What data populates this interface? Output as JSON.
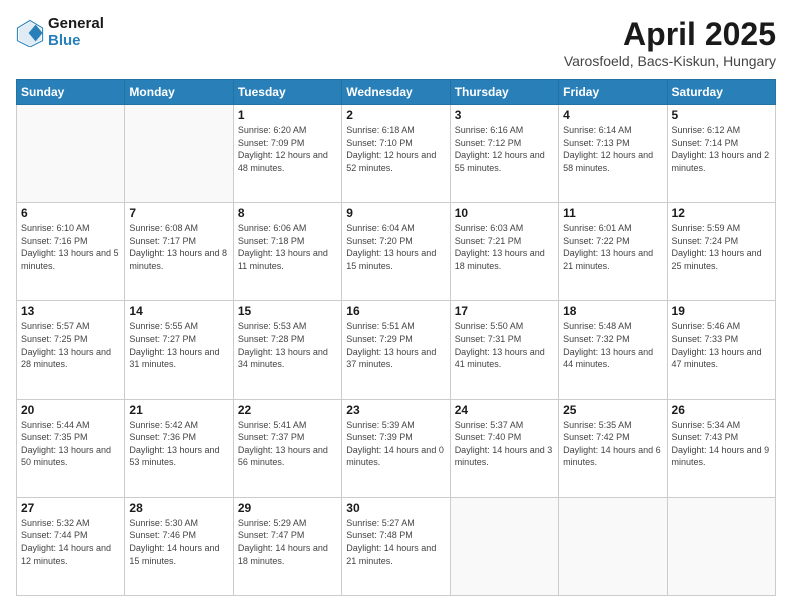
{
  "header": {
    "logo_line1": "General",
    "logo_line2": "Blue",
    "title": "April 2025",
    "subtitle": "Varosfoeld, Bacs-Kiskun, Hungary"
  },
  "days_of_week": [
    "Sunday",
    "Monday",
    "Tuesday",
    "Wednesday",
    "Thursday",
    "Friday",
    "Saturday"
  ],
  "weeks": [
    [
      {
        "num": "",
        "sunrise": "",
        "sunset": "",
        "daylight": ""
      },
      {
        "num": "",
        "sunrise": "",
        "sunset": "",
        "daylight": ""
      },
      {
        "num": "1",
        "sunrise": "Sunrise: 6:20 AM",
        "sunset": "Sunset: 7:09 PM",
        "daylight": "Daylight: 12 hours and 48 minutes."
      },
      {
        "num": "2",
        "sunrise": "Sunrise: 6:18 AM",
        "sunset": "Sunset: 7:10 PM",
        "daylight": "Daylight: 12 hours and 52 minutes."
      },
      {
        "num": "3",
        "sunrise": "Sunrise: 6:16 AM",
        "sunset": "Sunset: 7:12 PM",
        "daylight": "Daylight: 12 hours and 55 minutes."
      },
      {
        "num": "4",
        "sunrise": "Sunrise: 6:14 AM",
        "sunset": "Sunset: 7:13 PM",
        "daylight": "Daylight: 12 hours and 58 minutes."
      },
      {
        "num": "5",
        "sunrise": "Sunrise: 6:12 AM",
        "sunset": "Sunset: 7:14 PM",
        "daylight": "Daylight: 13 hours and 2 minutes."
      }
    ],
    [
      {
        "num": "6",
        "sunrise": "Sunrise: 6:10 AM",
        "sunset": "Sunset: 7:16 PM",
        "daylight": "Daylight: 13 hours and 5 minutes."
      },
      {
        "num": "7",
        "sunrise": "Sunrise: 6:08 AM",
        "sunset": "Sunset: 7:17 PM",
        "daylight": "Daylight: 13 hours and 8 minutes."
      },
      {
        "num": "8",
        "sunrise": "Sunrise: 6:06 AM",
        "sunset": "Sunset: 7:18 PM",
        "daylight": "Daylight: 13 hours and 11 minutes."
      },
      {
        "num": "9",
        "sunrise": "Sunrise: 6:04 AM",
        "sunset": "Sunset: 7:20 PM",
        "daylight": "Daylight: 13 hours and 15 minutes."
      },
      {
        "num": "10",
        "sunrise": "Sunrise: 6:03 AM",
        "sunset": "Sunset: 7:21 PM",
        "daylight": "Daylight: 13 hours and 18 minutes."
      },
      {
        "num": "11",
        "sunrise": "Sunrise: 6:01 AM",
        "sunset": "Sunset: 7:22 PM",
        "daylight": "Daylight: 13 hours and 21 minutes."
      },
      {
        "num": "12",
        "sunrise": "Sunrise: 5:59 AM",
        "sunset": "Sunset: 7:24 PM",
        "daylight": "Daylight: 13 hours and 25 minutes."
      }
    ],
    [
      {
        "num": "13",
        "sunrise": "Sunrise: 5:57 AM",
        "sunset": "Sunset: 7:25 PM",
        "daylight": "Daylight: 13 hours and 28 minutes."
      },
      {
        "num": "14",
        "sunrise": "Sunrise: 5:55 AM",
        "sunset": "Sunset: 7:27 PM",
        "daylight": "Daylight: 13 hours and 31 minutes."
      },
      {
        "num": "15",
        "sunrise": "Sunrise: 5:53 AM",
        "sunset": "Sunset: 7:28 PM",
        "daylight": "Daylight: 13 hours and 34 minutes."
      },
      {
        "num": "16",
        "sunrise": "Sunrise: 5:51 AM",
        "sunset": "Sunset: 7:29 PM",
        "daylight": "Daylight: 13 hours and 37 minutes."
      },
      {
        "num": "17",
        "sunrise": "Sunrise: 5:50 AM",
        "sunset": "Sunset: 7:31 PM",
        "daylight": "Daylight: 13 hours and 41 minutes."
      },
      {
        "num": "18",
        "sunrise": "Sunrise: 5:48 AM",
        "sunset": "Sunset: 7:32 PM",
        "daylight": "Daylight: 13 hours and 44 minutes."
      },
      {
        "num": "19",
        "sunrise": "Sunrise: 5:46 AM",
        "sunset": "Sunset: 7:33 PM",
        "daylight": "Daylight: 13 hours and 47 minutes."
      }
    ],
    [
      {
        "num": "20",
        "sunrise": "Sunrise: 5:44 AM",
        "sunset": "Sunset: 7:35 PM",
        "daylight": "Daylight: 13 hours and 50 minutes."
      },
      {
        "num": "21",
        "sunrise": "Sunrise: 5:42 AM",
        "sunset": "Sunset: 7:36 PM",
        "daylight": "Daylight: 13 hours and 53 minutes."
      },
      {
        "num": "22",
        "sunrise": "Sunrise: 5:41 AM",
        "sunset": "Sunset: 7:37 PM",
        "daylight": "Daylight: 13 hours and 56 minutes."
      },
      {
        "num": "23",
        "sunrise": "Sunrise: 5:39 AM",
        "sunset": "Sunset: 7:39 PM",
        "daylight": "Daylight: 14 hours and 0 minutes."
      },
      {
        "num": "24",
        "sunrise": "Sunrise: 5:37 AM",
        "sunset": "Sunset: 7:40 PM",
        "daylight": "Daylight: 14 hours and 3 minutes."
      },
      {
        "num": "25",
        "sunrise": "Sunrise: 5:35 AM",
        "sunset": "Sunset: 7:42 PM",
        "daylight": "Daylight: 14 hours and 6 minutes."
      },
      {
        "num": "26",
        "sunrise": "Sunrise: 5:34 AM",
        "sunset": "Sunset: 7:43 PM",
        "daylight": "Daylight: 14 hours and 9 minutes."
      }
    ],
    [
      {
        "num": "27",
        "sunrise": "Sunrise: 5:32 AM",
        "sunset": "Sunset: 7:44 PM",
        "daylight": "Daylight: 14 hours and 12 minutes."
      },
      {
        "num": "28",
        "sunrise": "Sunrise: 5:30 AM",
        "sunset": "Sunset: 7:46 PM",
        "daylight": "Daylight: 14 hours and 15 minutes."
      },
      {
        "num": "29",
        "sunrise": "Sunrise: 5:29 AM",
        "sunset": "Sunset: 7:47 PM",
        "daylight": "Daylight: 14 hours and 18 minutes."
      },
      {
        "num": "30",
        "sunrise": "Sunrise: 5:27 AM",
        "sunset": "Sunset: 7:48 PM",
        "daylight": "Daylight: 14 hours and 21 minutes."
      },
      {
        "num": "",
        "sunrise": "",
        "sunset": "",
        "daylight": ""
      },
      {
        "num": "",
        "sunrise": "",
        "sunset": "",
        "daylight": ""
      },
      {
        "num": "",
        "sunrise": "",
        "sunset": "",
        "daylight": ""
      }
    ]
  ]
}
